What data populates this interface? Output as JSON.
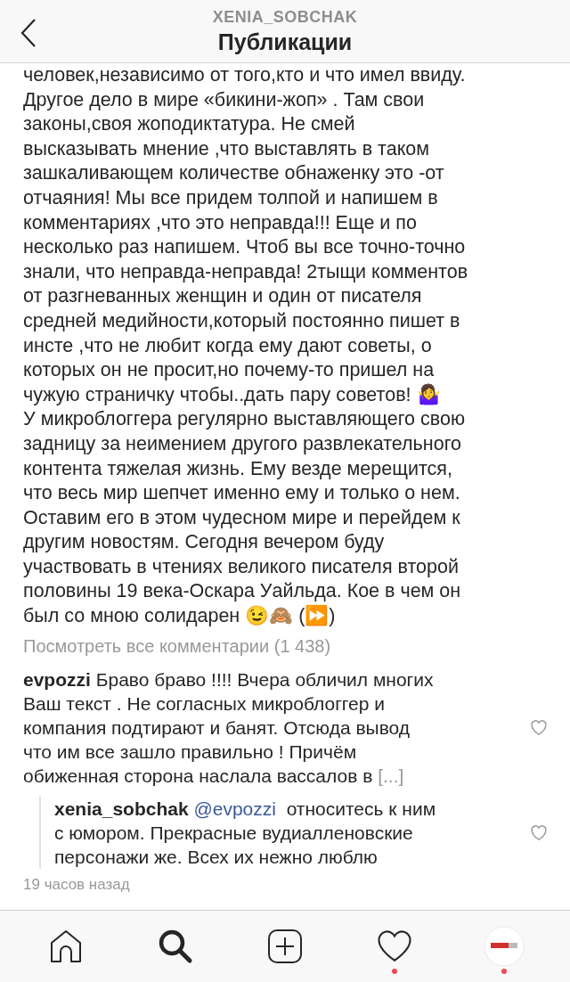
{
  "header": {
    "username": "XENIA_SOBCHAK",
    "title": "Публикации"
  },
  "caption": {
    "lines": [
      "человек,независимо от того,кто и что имел ввиду.",
      "Другое дело в мире «бикини-жоп» . Там свои",
      "законы,своя жоподиктатура. Не смей",
      "высказывать мнение ,что выставлять в таком",
      "зашкаливающем количестве обнаженку это -от",
      "отчаяния! Мы все придем толпой и напишем в",
      "комментариях ,что это неправда!!! Еще и по",
      "несколько раз напишем. Чтоб вы все точно-точно",
      "знали, что неправда-неправда! 2тыщи комментов",
      "от разгневанных женщин и один от писателя",
      "средней медийности,который постоянно пишет в",
      "инсте ,что не любит когда ему дают советы, о",
      "которых он не просит,но почему-то пришел на",
      "чужую страничку чтобы..дать пару советов! 🤷‍♀️",
      "У микроблоггера регулярно выставляющего свою",
      "задницу за неимением другого развлекательного",
      "контента тяжелая жизнь. Ему везде мерещится,",
      "что весь мир шепчет именно ему и только о нем.",
      "Оставим его в этом чудесном мире и перейдем к",
      "другим новостям. Сегодня вечером буду",
      "участвовать в чтениях великого писателя второй",
      "половины 19 века-Оскара Уайльда. Кое в чем он",
      "был со мною солидарен 😉🙈 (⏩)"
    ]
  },
  "view_all_comments": "Посмотреть все комментарии (1 438)",
  "comments": [
    {
      "username": "evpozzi",
      "lines": [
        "Браво браво !!!! Вчера обличил многих",
        "Ваш текст . Не согласных микроблоггер и",
        "компания подтирают и банят. Отсюда вывод",
        "что им все зашло правильно ! Причём",
        "обиженная сторона наслала вассалов в"
      ],
      "more": "[...]",
      "liked": false,
      "replies": [
        {
          "username": "xenia_sobchak",
          "mention": "@evpozzi",
          "lines": [
            "относитесь к ним",
            "с юмором. Прекрасные вудиалленовские",
            "персонажи же. Всех их нежно люблю"
          ],
          "liked": false
        }
      ]
    }
  ],
  "timestamp": "19 часов назад",
  "tab_bar": [
    {
      "kind": "home",
      "selected": false,
      "badge": false
    },
    {
      "kind": "search",
      "selected": true,
      "badge": false
    },
    {
      "kind": "add",
      "selected": false,
      "badge": false
    },
    {
      "kind": "activity",
      "selected": false,
      "badge": true
    },
    {
      "kind": "profile",
      "selected": false,
      "badge": true
    }
  ]
}
